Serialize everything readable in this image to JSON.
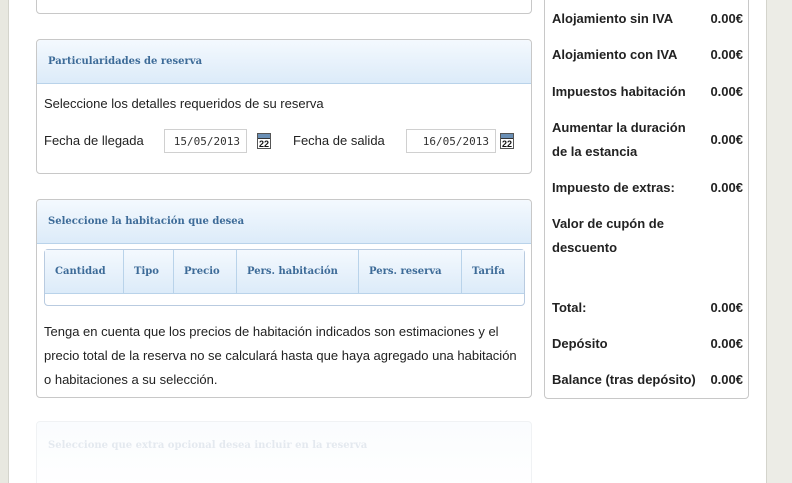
{
  "reservation_details": {
    "header": "Particularidades de reserva",
    "description": "Seleccione los detalles requeridos de su reserva",
    "arrival_label": "Fecha de llegada",
    "arrival_value": "15/05/2013",
    "departure_label": "Fecha de salida",
    "departure_value": "16/05/2013",
    "calendar_day": "22"
  },
  "room_selection": {
    "header": "Seleccione la habitación que desea",
    "columns": [
      "Cantidad",
      "Tipo",
      "Precio",
      "Pers. habitación",
      "Pers. reserva",
      "Tarifa"
    ],
    "note": "Tenga en cuenta que los precios de habitación indicados son estimaciones y el precio total de la reserva no se calculará hasta que haya agregado una habitación o habitaciones a su selección."
  },
  "extras": {
    "header": "Seleccione que extra opcional desea incluir en la reserva"
  },
  "summary": {
    "items": [
      {
        "label": "Alojamiento sin IVA",
        "value": "0.00€"
      },
      {
        "label": "Alojamiento con IVA",
        "value": "0.00€"
      },
      {
        "label": "Impuestos habitación",
        "value": "0.00€"
      },
      {
        "label": "Aumentar la duración de la estancia",
        "value": "0.00€"
      },
      {
        "label": "Impuesto de extras:",
        "value": "0.00€"
      },
      {
        "label": "Valor de cupón de descuento",
        "value": ""
      },
      {
        "label": "Total:",
        "value": "0.00€"
      },
      {
        "label": "Depósito",
        "value": "0.00€"
      },
      {
        "label": "Balance (tras depósito)",
        "value": "0.00€"
      }
    ]
  }
}
